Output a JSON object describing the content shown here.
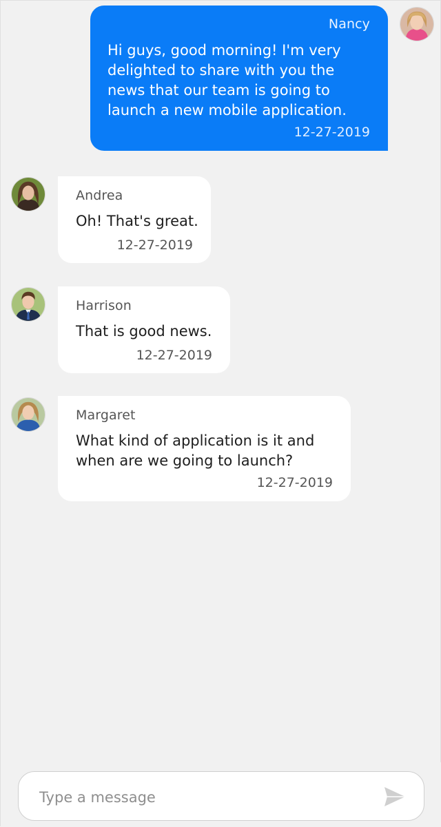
{
  "messages": [
    {
      "sender": "Nancy",
      "text": "Hi guys, good morning! I'm very\ndelighted to share with you the\nnews that our team is going to\nlaunch a new mobile application.",
      "time": "12-27-2019",
      "direction": "outgoing"
    },
    {
      "sender": "Andrea",
      "text": "Oh! That's great.",
      "time": "12-27-2019",
      "direction": "incoming"
    },
    {
      "sender": "Harrison",
      "text": "That is good news.",
      "time": "12-27-2019",
      "direction": "incoming"
    },
    {
      "sender": "Margaret",
      "text": "What kind of application is it and\nwhen are we going to launch?",
      "time": "12-27-2019",
      "direction": "incoming"
    }
  ],
  "composer": {
    "placeholder": "Type a message",
    "value": "",
    "send_icon": "send-icon"
  },
  "colors": {
    "outgoing_bubble": "#0a7cf7",
    "incoming_bubble": "#ffffff",
    "background": "#f1f1f1"
  }
}
